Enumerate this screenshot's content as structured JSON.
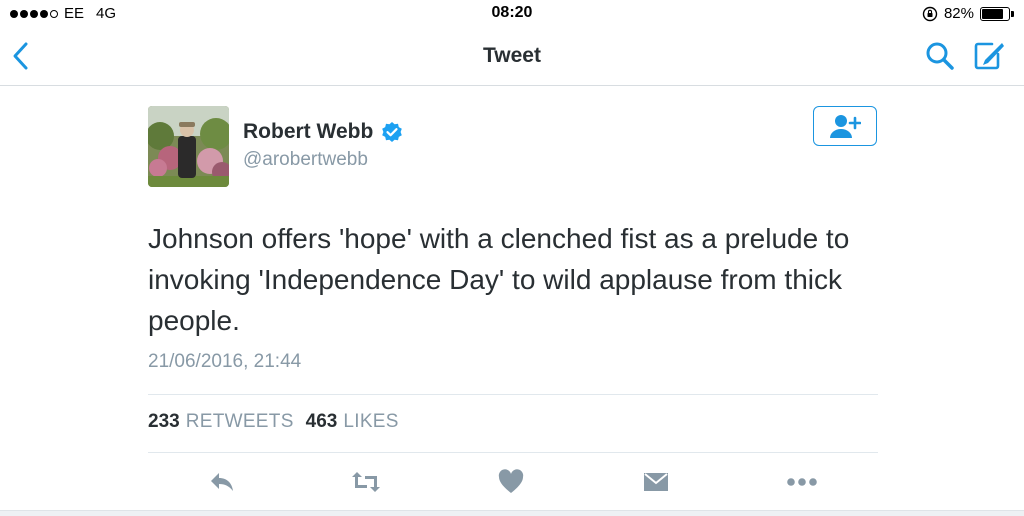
{
  "status_bar": {
    "carrier": "EE",
    "network": "4G",
    "time": "08:20",
    "battery_percent": "82%",
    "battery_level": 0.82,
    "signal_bars_filled": 4,
    "signal_bars_total": 5
  },
  "nav": {
    "title": "Tweet",
    "back_icon": "chevron-left-icon",
    "search_icon": "search-icon",
    "compose_icon": "compose-icon"
  },
  "tweet": {
    "author_name": "Robert Webb",
    "handle": "@arobertwebb",
    "verified": true,
    "text": "Johnson offers 'hope' with a clenched fist as a prelude to invoking 'Independence Day' to wild applause from thick people.",
    "timestamp": "21/06/2016, 21:44",
    "retweets_count": "233",
    "retweets_label": "RETWEETS",
    "likes_count": "463",
    "likes_label": "LIKES"
  },
  "actions": [
    "reply-icon",
    "retweet-icon",
    "like-icon",
    "direct-message-icon",
    "more-icon"
  ],
  "colors": {
    "accent": "#1b95e0",
    "text": "#292f33",
    "muted": "#8899a6",
    "action_icon": "#8899a6"
  }
}
